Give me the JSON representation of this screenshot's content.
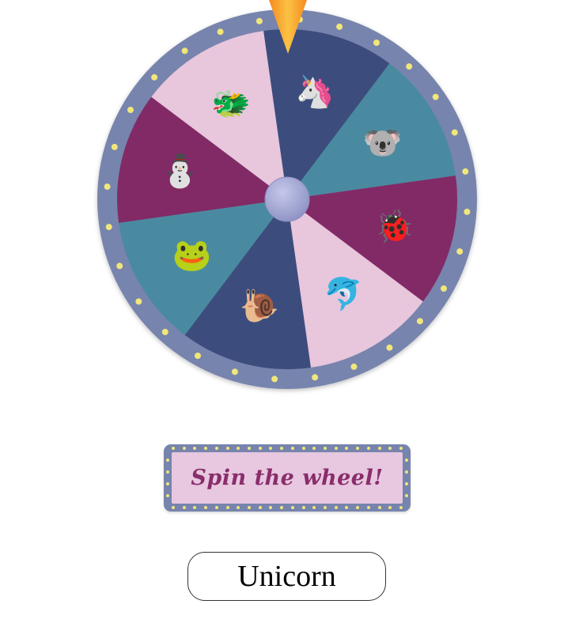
{
  "wheel": {
    "segments": [
      {
        "name": "unicorn",
        "icon": "unicorn-icon",
        "glyph": "🦄",
        "color": "#3c4d7d"
      },
      {
        "name": "koala",
        "icon": "koala-icon",
        "glyph": "🐨",
        "color": "#4a8aa0"
      },
      {
        "name": "ladybug",
        "icon": "ladybug-icon",
        "glyph": "🐞",
        "color": "#822a66"
      },
      {
        "name": "dolphin",
        "icon": "dolphin-icon",
        "glyph": "🐬",
        "color": "#e8c6dc"
      },
      {
        "name": "snail",
        "icon": "snail-icon",
        "glyph": "🐌",
        "color": "#3c4d7d"
      },
      {
        "name": "frog",
        "icon": "frog-icon",
        "glyph": "🐸",
        "color": "#4a8aa0"
      },
      {
        "name": "snowman",
        "icon": "snowman-icon",
        "glyph": "⛄",
        "color": "#822a66"
      },
      {
        "name": "dragon",
        "icon": "dragon-icon",
        "glyph": "🐲",
        "color": "#e8c6dc"
      }
    ],
    "rim_color": "#7784ad",
    "bulb_color": "#f1e67a",
    "hub_color": "#9b9fd0",
    "pointer_color": "#f7a02a"
  },
  "spin_button": {
    "label": "Spin the wheel!"
  },
  "result": {
    "text": "Unicorn"
  }
}
